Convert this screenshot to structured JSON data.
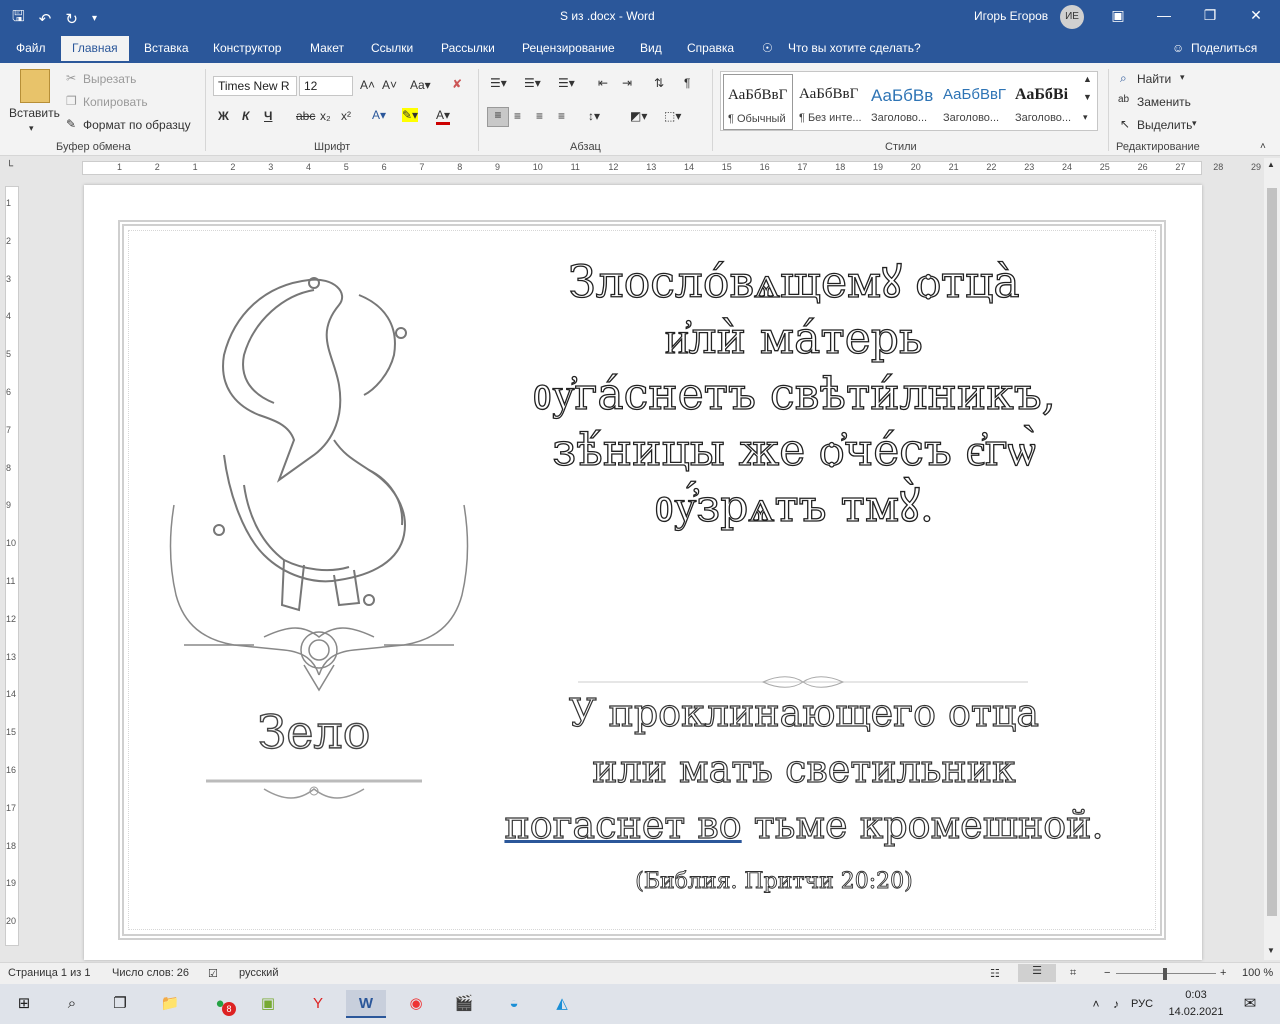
{
  "titlebar": {
    "doc_title": "S из .docx  -  Word",
    "user_name": "Игорь Егоров",
    "user_initials": "ИЕ"
  },
  "tabs": [
    "Файл",
    "Главная",
    "Вставка",
    "Конструктор",
    "Макет",
    "Ссылки",
    "Рассылки",
    "Рецензирование",
    "Вид",
    "Справка"
  ],
  "tell_me": "Что вы хотите сделать?",
  "share": "Поделиться",
  "clipboard": {
    "paste": "Вставить",
    "cut": "Вырезать",
    "copy": "Копировать",
    "format_painter": "Формат по образцу",
    "label": "Буфер обмена"
  },
  "font": {
    "name": "Times New R",
    "size": "12",
    "bold": "Ж",
    "italic": "К",
    "underline": "Ч",
    "label": "Шрифт"
  },
  "paragraph": {
    "label": "Абзац"
  },
  "styles": {
    "items": [
      {
        "sample": "АаБбВвГ",
        "name": "¶ Обычный"
      },
      {
        "sample": "АаБбВвГ",
        "name": "¶ Без инте..."
      },
      {
        "sample": "АаБбВв",
        "name": "Заголово..."
      },
      {
        "sample": "АаБбВвГ",
        "name": "Заголово..."
      },
      {
        "sample": "АаБбВі",
        "name": "Заголово..."
      }
    ],
    "label": "Стили"
  },
  "editing": {
    "find": "Найти",
    "replace": "Заменить",
    "select": "Выделить",
    "label": "Редактирование"
  },
  "ruler_h": [
    "1",
    "2",
    "1",
    "2",
    "3",
    "4",
    "5",
    "6",
    "7",
    "8",
    "9",
    "10",
    "11",
    "12",
    "13",
    "14",
    "15",
    "16",
    "17",
    "18",
    "19",
    "20",
    "21",
    "22",
    "23",
    "24",
    "25",
    "26",
    "27",
    "28",
    "29"
  ],
  "ruler_v": [
    "1",
    "2",
    "3",
    "4",
    "5",
    "6",
    "7",
    "8",
    "9",
    "10",
    "11",
    "12",
    "13",
    "14",
    "15",
    "16",
    "17",
    "18",
    "19",
    "20"
  ],
  "document": {
    "cs_lines": [
      "Злослóвѧщемꙋ ѻтцà",
      "и҆лѝ ма́терь",
      "ᲂу҆га́снетъ свѣти́лникъ,",
      "зѣ́ницы же ѻ҆че́съ є҆гѡ̀",
      "ᲂу҆́зрѧтъ тмꙋ̀."
    ],
    "ru_lines": [
      "У проклинающего отца",
      "или мать светильник"
    ],
    "ru_last_underlined": "погаснет  во",
    "ru_last_rest": " тьме кромешной.",
    "citation": "(Библия.  Притчи 20:20)",
    "initial_word": "Зело"
  },
  "status": {
    "page": "Страница 1 из 1",
    "words": "Число слов: 26",
    "language": "русский",
    "zoom": "100 %"
  },
  "taskbar": {
    "lang": "РУС",
    "time": "0:03",
    "date": "14.02.2021",
    "whatsapp_badge": "8"
  },
  "colors": {
    "accent": "#2b579a",
    "ribbon_bg": "#f3f3f3"
  }
}
